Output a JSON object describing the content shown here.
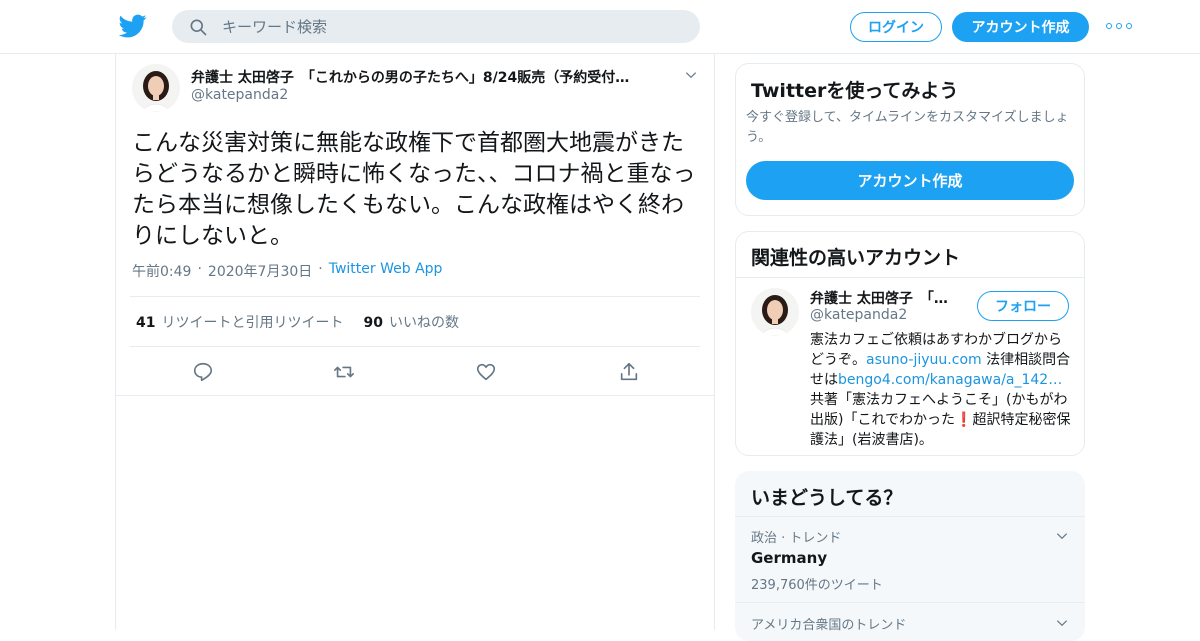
{
  "header": {
    "search_placeholder": "キーワード検索",
    "login_label": "ログイン",
    "signup_label": "アカウント作成",
    "icons": [
      "twitter-bird-icon",
      "search-icon",
      "more-icon"
    ]
  },
  "tweet": {
    "author_name": "弁護士 太田啓子　「これからの男の子たちへ」8/24販売（予約受付…",
    "handle": "@katepanda2",
    "text": "こんな災害対策に無能な政権下で首都圏大地震がきたらどうなるかと瞬時に怖くなった、、コロナ禍と重なったら本当に想像したくもない。こんな政権はやく終わりにしないと。",
    "time": "午前0:49",
    "dot1": "·",
    "date": "2020年7月30日",
    "dot2": "·",
    "source": "Twitter Web App",
    "retweets_count": "41",
    "retweets_label": "リツイートと引用リツイート",
    "likes_count": "90",
    "likes_label": "いいねの数",
    "actions": [
      "reply-icon",
      "retweet-icon",
      "like-icon",
      "share-icon"
    ]
  },
  "signup_card": {
    "title": "Twitterを使ってみよう",
    "subtitle": "今すぐ登録して、タイムラインをカスタマイズしましょう。",
    "button": "アカウント作成"
  },
  "related": {
    "title": "関連性の高いアカウント",
    "name": "弁護士 太田啓子　「…",
    "handle": "@katepanda2",
    "follow": "フォロー",
    "bio_1": "憲法カフェご依頼はあすわかブログからどうぞ。",
    "bio_link1": "asuno-jiyuu.com",
    "bio_2": " 法律相談問合せは",
    "bio_link2": "bengo4.com/kanagawa/a_142…",
    "bio_3": " 共著「憲法カフェへようこそ」(かもがわ出版)「これでわかった",
    "bio_excl": "❗",
    "bio_4": "超訳特定秘密保護法」(岩波書店)。"
  },
  "trends": {
    "title": "いまどうしてる？",
    "items": [
      {
        "context": "政治 · トレンド",
        "topic": "Germany",
        "count": "239,760件のツイート"
      },
      {
        "context": "アメリカ合衆国のトレンド",
        "topic": "",
        "count": ""
      }
    ]
  },
  "colors": {
    "accent": "#1da1f2",
    "link": "#1b95e0",
    "muted": "#657786",
    "border": "#e6ecf0"
  }
}
